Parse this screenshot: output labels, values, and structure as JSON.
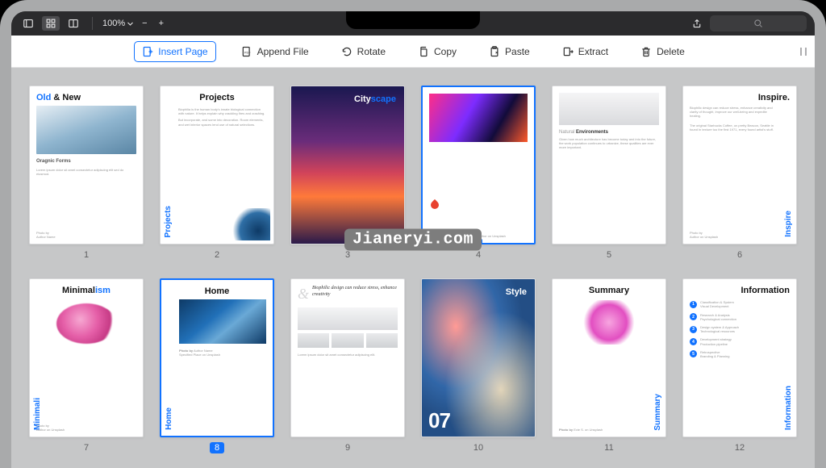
{
  "topbar": {
    "zoom": "100%",
    "search_placeholder": ""
  },
  "toolbar": {
    "insert": "Insert Page",
    "append": "Append File",
    "rotate": "Rotate",
    "copy": "Copy",
    "paste": "Paste",
    "extract": "Extract",
    "delete": "Delete"
  },
  "pages": [
    {
      "num": "1",
      "title_a": "Old",
      "title_b": " & New",
      "sub": "Oragnic Forms",
      "selected": false
    },
    {
      "num": "2",
      "title": "Projects",
      "side": "Projects",
      "selected": false
    },
    {
      "num": "3",
      "overlay_a": "City",
      "overlay_b": "scape",
      "selected": false
    },
    {
      "num": "4",
      "selected": true
    },
    {
      "num": "5",
      "caption_a": "Natural",
      "caption_b": " Environments",
      "selected": false
    },
    {
      "num": "6",
      "title": "Inspire.",
      "side": "Inspire",
      "selected": false
    },
    {
      "num": "7",
      "title_a": "Minimal",
      "title_b": "ism",
      "side": "Minimali",
      "selected": false
    },
    {
      "num": "8",
      "title": "Home",
      "side": "Home",
      "selected": true,
      "num_selected": true
    },
    {
      "num": "9",
      "quote": "Biophilic design can reduce stress, enhance creativity",
      "selected": false
    },
    {
      "num": "10",
      "overlay": "Style",
      "bignum": "07",
      "selected": false
    },
    {
      "num": "11",
      "title": "Summary",
      "side": "Summary",
      "selected": false
    },
    {
      "num": "12",
      "title": "Information",
      "side": "Information",
      "items": [
        "1",
        "2",
        "3",
        "4",
        "5"
      ],
      "selected": false
    }
  ],
  "watermark": "Jianeryi.com"
}
